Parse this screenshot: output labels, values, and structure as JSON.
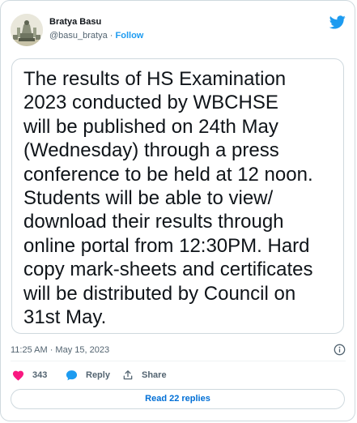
{
  "author": {
    "display_name": "Bratya Basu",
    "handle": "@basu_bratya",
    "separator": "·",
    "follow_label": "Follow",
    "avatar_icon": "avatar-statue-icon"
  },
  "brand": {
    "logo_icon": "twitter-bird-icon",
    "accent_color": "#1d9bf0"
  },
  "tweet": {
    "text": "The results of HS Examination\n2023 conducted by WBCHSE\nwill be published on 24th May\n(Wednesday) through a press\nconference to be held at 12 noon.\nStudents will be able to view/\ndownload their results through\nonline portal from 12:30PM. Hard\ncopy mark-sheets and certificates\nwill be distributed by Council on\n31st May.",
    "timestamp": "11:25 AM · May 15, 2023"
  },
  "actions": {
    "like_count": "343",
    "like_icon": "heart-icon",
    "like_color": "#f91880",
    "reply_label": "Reply",
    "reply_icon": "speech-bubble-icon",
    "share_label": "Share",
    "share_icon": "share-icon"
  },
  "replies_button_label": "Read 22 replies",
  "info_icon": "info-icon"
}
